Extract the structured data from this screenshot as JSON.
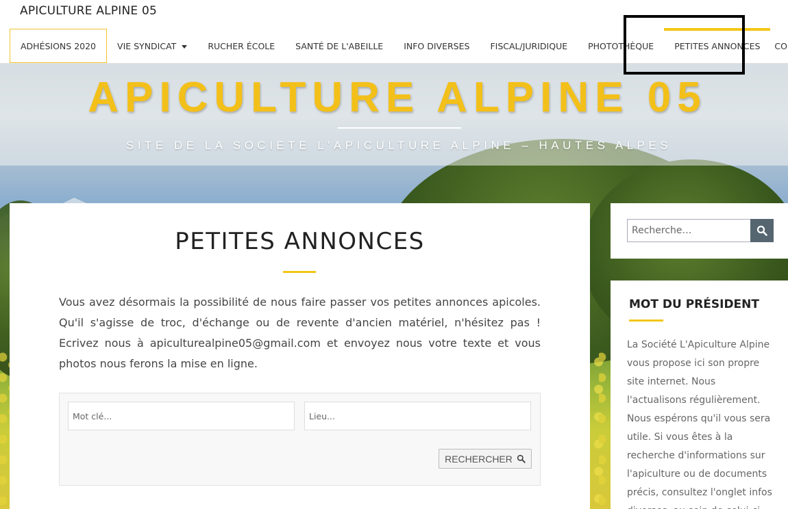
{
  "header": {
    "brand": "APICULTURE ALPINE 05",
    "nav": [
      {
        "label": "ADHÉSIONS 2020"
      },
      {
        "label": "VIE SYNDICAT"
      },
      {
        "label": "RUCHER ÉCOLE"
      },
      {
        "label": "SANTÉ DE L'ABEILLE"
      },
      {
        "label": "INFO DIVERSES"
      },
      {
        "label": "FISCAL/JURIDIQUE"
      },
      {
        "label": "PHOTOTHÈQUE"
      },
      {
        "label": "PETITES ANNONCES"
      },
      {
        "label": "CONTACT"
      }
    ],
    "active_item": "PETITES ANNONCES"
  },
  "hero": {
    "title": "APICULTURE ALPINE 05",
    "tagline": "SITE DE LA SOCIETE L'APICULTURE ALPINE – HAUTES ALPES"
  },
  "article": {
    "title": "PETITES ANNONCES",
    "body": "Vous avez désormais la possibilité de nous faire passer vos petites annonces apicoles. Qu'il s'agisse de troc, d'échange ou de revente d'ancien matériel, n'hésitez pas ! Ecrivez nous à apiculturealpine05@gmail.com et envoyez nous votre texte et vous photos nous ferons la mise en ligne.",
    "form": {
      "keyword_placeholder": "Mot clé...",
      "location_placeholder": "Lieu...",
      "submit_label": "RECHERCHER"
    }
  },
  "sidebar": {
    "search_placeholder": "Recherche…",
    "president_title": "MOT DU PRÉSIDENT",
    "president_text": "La Société L'Apiculture Alpine vous propose ici son propre site internet. Nous l'actualisons régulièrement. Nous espérons qu'il vous sera utile. Si vous êtes à la recherche d'informations sur l'apiculture ou de documents précis, consultez l'onglet infos diverses, au sein de celui-ci."
  },
  "colors": {
    "accent": "#f3c614",
    "title_yellow": "#f3c01a",
    "search_button": "#566670"
  }
}
